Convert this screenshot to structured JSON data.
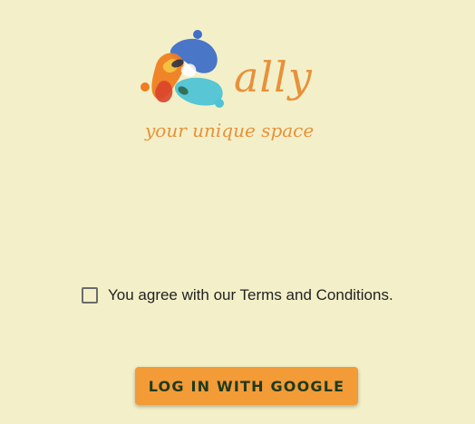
{
  "brand": {
    "name": "ally",
    "tagline": "your unique space",
    "logo_icon": "ally-logo-icon"
  },
  "terms": {
    "checked": false,
    "label": "You agree with our Terms and Conditions."
  },
  "login": {
    "label": "LOG IN WITH GOOGLE"
  },
  "colors": {
    "background": "#f3f0c9",
    "accent": "#e8913a",
    "button": "#f29b37",
    "button_text": "#1f3a1c"
  }
}
